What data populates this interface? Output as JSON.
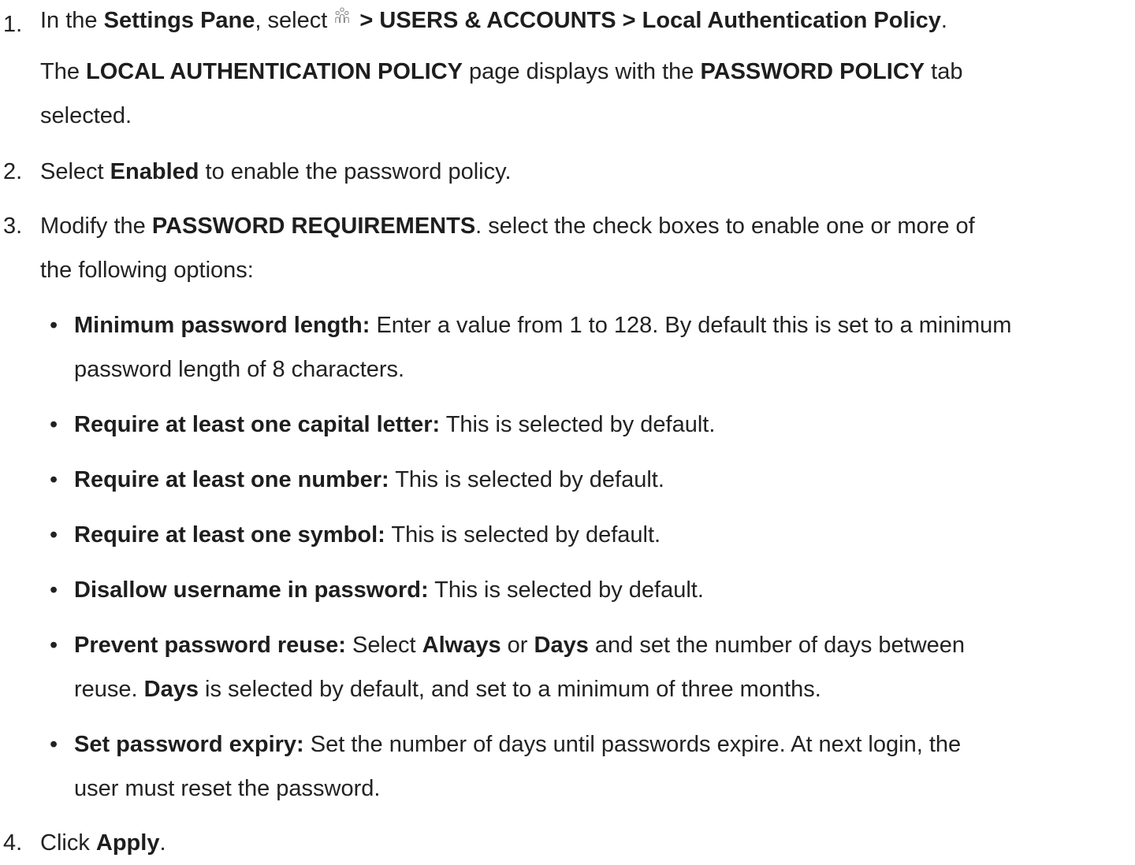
{
  "steps": [
    {
      "number": "1.",
      "lines": [
        [
          "In the ",
          "Settings Pane",
          ", select ",
          " > USERS & ACCOUNTS > Local Authentication Policy",
          "."
        ],
        [
          "The ",
          "LOCAL AUTHENTICATION POLICY",
          " page displays with the ",
          "PASSWORD POLICY",
          " tab"
        ],
        [
          "selected."
        ]
      ],
      "icon": "users-icon"
    },
    {
      "number": "2.",
      "lines": [
        [
          "Select ",
          "Enabled",
          " to enable the password policy."
        ]
      ]
    },
    {
      "number": "3.",
      "lines": [
        [
          "Modify the ",
          "PASSWORD REQUIREMENTS",
          ". select the check boxes to enable one or more of"
        ],
        [
          "the following options:"
        ]
      ]
    },
    {
      "number": "4.",
      "lines": [
        [
          "Click ",
          "Apply",
          "."
        ]
      ]
    }
  ],
  "bullets": [
    {
      "lines": [
        [
          "Minimum password length:",
          " Enter a value from 1 to 128. By default this is set to a minimum"
        ],
        [
          "password length of 8 characters."
        ]
      ]
    },
    {
      "lines": [
        [
          "Require at least one capital letter:",
          " This is selected by default."
        ]
      ]
    },
    {
      "lines": [
        [
          "Require at least one number:",
          " This is selected by default."
        ]
      ]
    },
    {
      "lines": [
        [
          "Require at least one symbol:",
          " This is selected by default."
        ]
      ]
    },
    {
      "lines": [
        [
          "Disallow username in password:",
          " This is selected by default."
        ]
      ]
    },
    {
      "lines": [
        [
          "Prevent password reuse:",
          " Select ",
          "Always",
          " or ",
          "Days",
          " and set the number of days between"
        ],
        [
          "reuse. ",
          "Days",
          " is selected by default, and set to a minimum of three months."
        ]
      ]
    },
    {
      "lines": [
        [
          "Set password expiry:",
          " Set the number of days until passwords expire. At next login, the"
        ],
        [
          "user must reset the password."
        ]
      ]
    }
  ],
  "bullet_glyph": "•"
}
